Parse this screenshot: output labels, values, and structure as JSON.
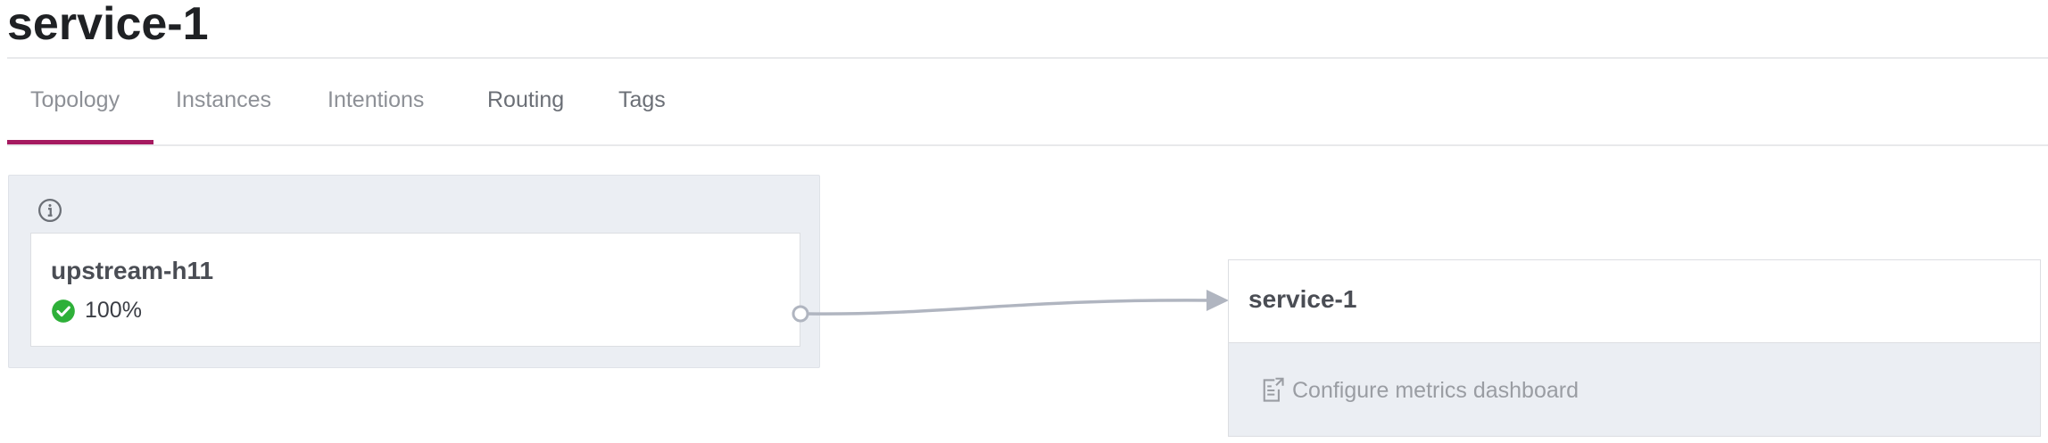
{
  "page": {
    "title": "service-1"
  },
  "tabs": [
    {
      "label": "Topology",
      "active": true
    },
    {
      "label": "Instances"
    },
    {
      "label": "Intentions"
    },
    {
      "label": "Routing"
    },
    {
      "label": "Tags"
    }
  ],
  "topology": {
    "upstream": {
      "name": "upstream-h11",
      "health_percent": "100%",
      "health_status": "passing",
      "info_icon": "info-icon",
      "status_icon": "check-circle-icon"
    },
    "service": {
      "name": "service-1",
      "metrics_link_label": "Configure metrics dashboard",
      "metrics_icon": "external-doc-icon"
    }
  },
  "colors": {
    "accent": "#a51a60",
    "health_ok": "#2eb039",
    "panel_bg": "#ebeef3",
    "connector": "#b0b5c0"
  }
}
